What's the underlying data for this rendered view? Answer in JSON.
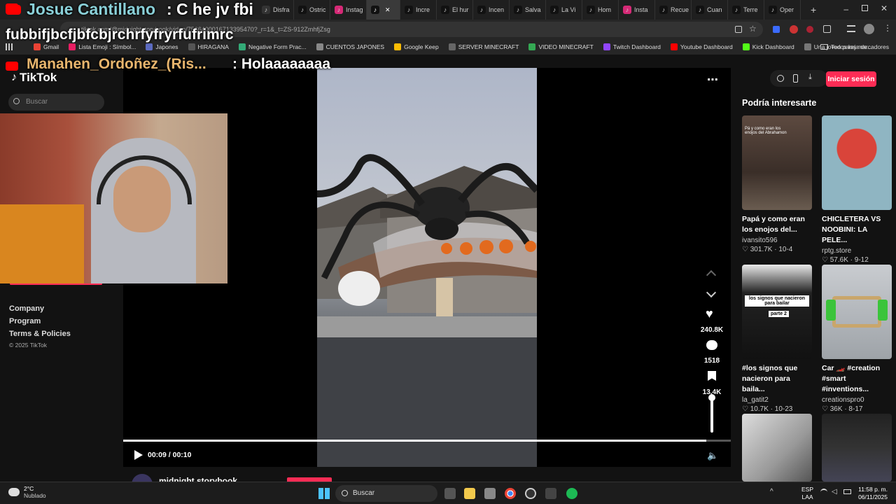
{
  "browser": {
    "tabs": [
      {
        "label": "Disfra",
        "color": "#333"
      },
      {
        "label": "Ostric",
        "color": "#111"
      },
      {
        "label": "Instag",
        "color": "#d62976"
      },
      {
        "label": "",
        "color": "#111"
      },
      {
        "label": "Incre",
        "color": "#111"
      },
      {
        "label": "El hur",
        "color": "#111"
      },
      {
        "label": "Incen",
        "color": "#111"
      },
      {
        "label": "Salva",
        "color": "#111"
      },
      {
        "label": "La Vi",
        "color": "#111"
      },
      {
        "label": "Hom",
        "color": "#111"
      },
      {
        "label": "Insta",
        "color": "#d62976"
      },
      {
        "label": "Recue",
        "color": "#111"
      },
      {
        "label": "Cuan",
        "color": "#111"
      },
      {
        "label": "Terre",
        "color": "#111"
      },
      {
        "label": "Oper",
        "color": "#111"
      }
    ],
    "url": "tiktok.com/@midnightstorybook/video/7566400016713395470?_r=1&_t=ZS-912ZmhfjZsg",
    "bookmarks": [
      {
        "label": "Gmail",
        "color": "#ea4335"
      },
      {
        "label": "Lista Emoji : Símbol...",
        "color": "#e91e63"
      },
      {
        "label": "Japones",
        "color": "#5c6bc0"
      },
      {
        "label": "HIRAGANA",
        "color": "#555"
      },
      {
        "label": "Negative Form Prac...",
        "color": "#3a7"
      },
      {
        "label": "CUENTOS JAPONES",
        "color": "#888"
      },
      {
        "label": "Google Keep",
        "color": "#fbbc04"
      },
      {
        "label": "SERVER MINECRAFT",
        "color": "#666"
      },
      {
        "label": "VIDEO MINECRAFT",
        "color": "#34a853"
      },
      {
        "label": "Twitch Dashboard",
        "color": "#9146ff"
      },
      {
        "label": "Youtube Dashboard",
        "color": "#ff0000"
      },
      {
        "label": "Kick Dashboard",
        "color": "#53fc18"
      },
      {
        "label": "Una joven pareja de...",
        "color": "#777"
      }
    ],
    "all_bookmarks": "Todos los marcadores"
  },
  "stream_overlay": {
    "chat1_user": "Josue Cantillano",
    "chat1_msg": ": C he jv fbi",
    "chat2_msg": "fubbifjbcfjbfcbjrchrfyfryrfufrimrc",
    "chat3_user": "Manahen_Ordoñez_(Ris...",
    "chat3_msg": ": Holaaaaaaaa"
  },
  "tiktok": {
    "logo": "TikTok",
    "search_placeholder": "Buscar",
    "sidebar_links": [
      "Company",
      "Program",
      "Terms & Policies"
    ],
    "copyright": "© 2025 TikTok",
    "login_button": "Iniciar sesión",
    "suggest_title": "Podría interesarte",
    "video": {
      "time": "00:09 / 00:10",
      "progress": 0.96,
      "likes": "240.8K",
      "comments": "1518",
      "saves": "13.4K",
      "author": "midnight.storybook",
      "thumb_caption": "Pá y como eran los enojos del Abrahamon"
    },
    "suggestions": [
      {
        "title": "Papá y como eran los enojos del...",
        "user": "ivansito596",
        "stats": "301.7K · 10-4"
      },
      {
        "title": "CHICLETERA VS NOOBINI: LA PELE...",
        "user": "rptg.store",
        "stats": "57.6K · 9-12"
      },
      {
        "title": "#los signos que nacieron para baila...",
        "user": "la_gatit2",
        "stats": "10.7K · 10-23",
        "caption": "los signos que nacieron para bailar",
        "part": "parte 2"
      },
      {
        "title": "Car 🏎️ #creation #smart #inventions...",
        "user": "creationspro0",
        "stats": "36K · 8-17"
      }
    ]
  },
  "taskbar": {
    "weather_temp": "2°C",
    "weather_desc": "Nublado",
    "search": "Buscar",
    "lang1": "ESP",
    "lang2": "LAA",
    "time": "11:58 p. m.",
    "date": "06/11/2025"
  }
}
